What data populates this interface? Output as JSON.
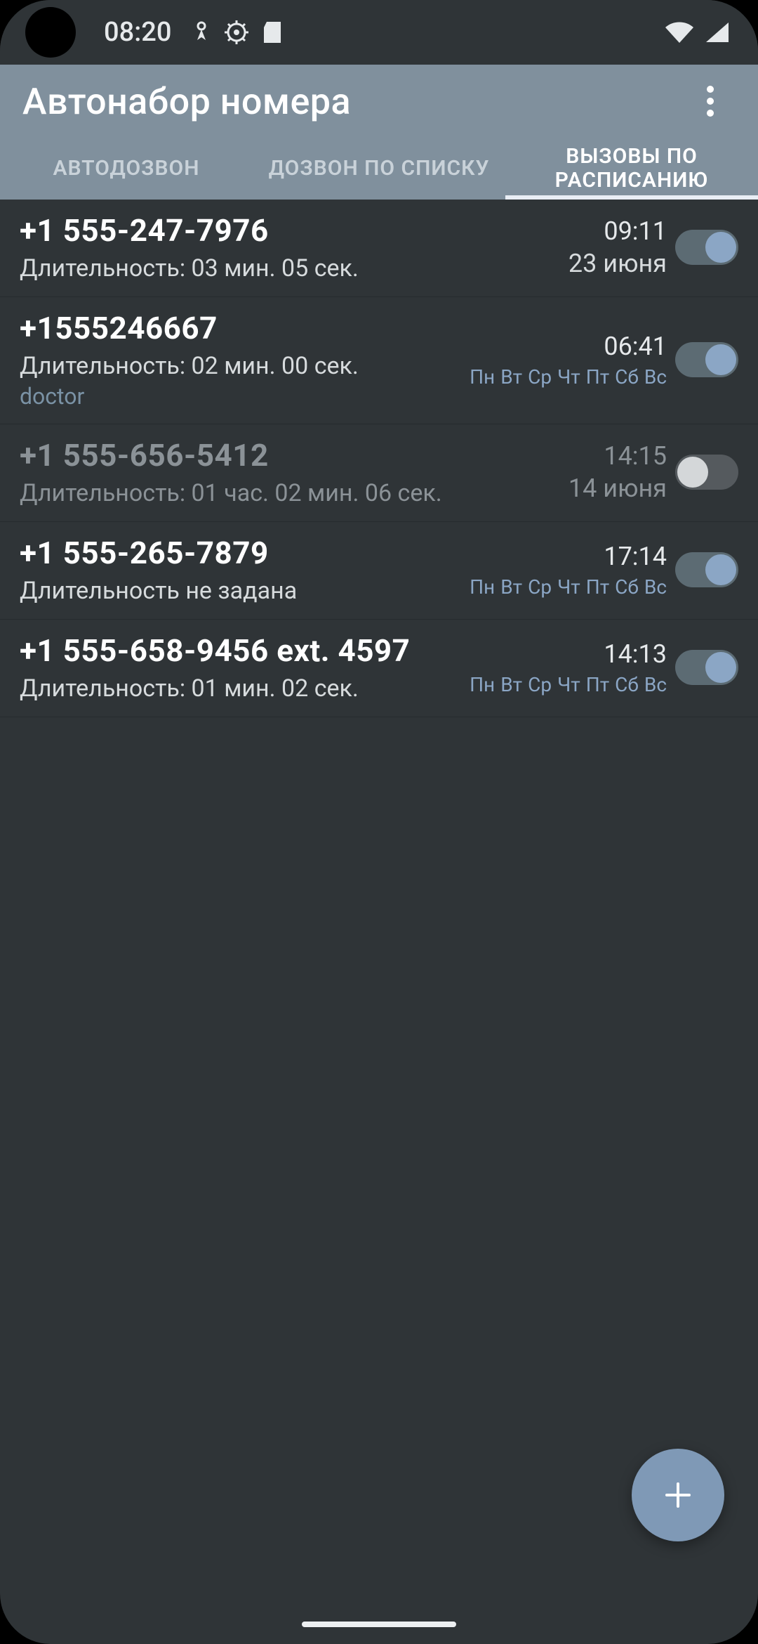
{
  "status": {
    "time": "08:20"
  },
  "app": {
    "title": "Автонабор номера"
  },
  "tabs": {
    "items": [
      {
        "label": "АВТОДОЗВОН"
      },
      {
        "label": "ДОЗВОН ПО СПИСКУ"
      },
      {
        "label": "ВЫЗОВЫ ПО РАСПИСАНИЮ"
      }
    ],
    "active_index": 2
  },
  "day_labels": [
    "Пн",
    "Вт",
    "Ср",
    "Чт",
    "Пт",
    "Сб",
    "Вс"
  ],
  "entries": [
    {
      "phone": "+1 555-247-7976",
      "duration": "Длительность: 03 мин. 05 сек.",
      "time": "09:11",
      "date": "23 июня",
      "days_on": null,
      "enabled": true,
      "tag": null
    },
    {
      "phone": "+1555246667",
      "duration": "Длительность: 02 мин. 00 сек.",
      "time": "06:41",
      "date": null,
      "days_on": [
        true,
        true,
        true,
        true,
        true,
        true,
        true
      ],
      "enabled": true,
      "tag": "doctor"
    },
    {
      "phone": "+1 555-656-5412",
      "duration": "Длительность: 01 час. 02 мин. 06 сек.",
      "time": "14:15",
      "date": "14 июня",
      "days_on": null,
      "enabled": false,
      "tag": null
    },
    {
      "phone": "+1 555-265-7879",
      "duration": "Длительность не задана",
      "time": "17:14",
      "date": null,
      "days_on": [
        true,
        true,
        true,
        true,
        true,
        true,
        true
      ],
      "enabled": true,
      "tag": null
    },
    {
      "phone": "+1 555-658-9456 ext. 4597",
      "duration": "Длительность: 01 мин. 02 сек.",
      "time": "14:13",
      "date": null,
      "days_on": [
        true,
        true,
        true,
        true,
        true,
        true,
        true
      ],
      "enabled": true,
      "tag": null
    }
  ]
}
